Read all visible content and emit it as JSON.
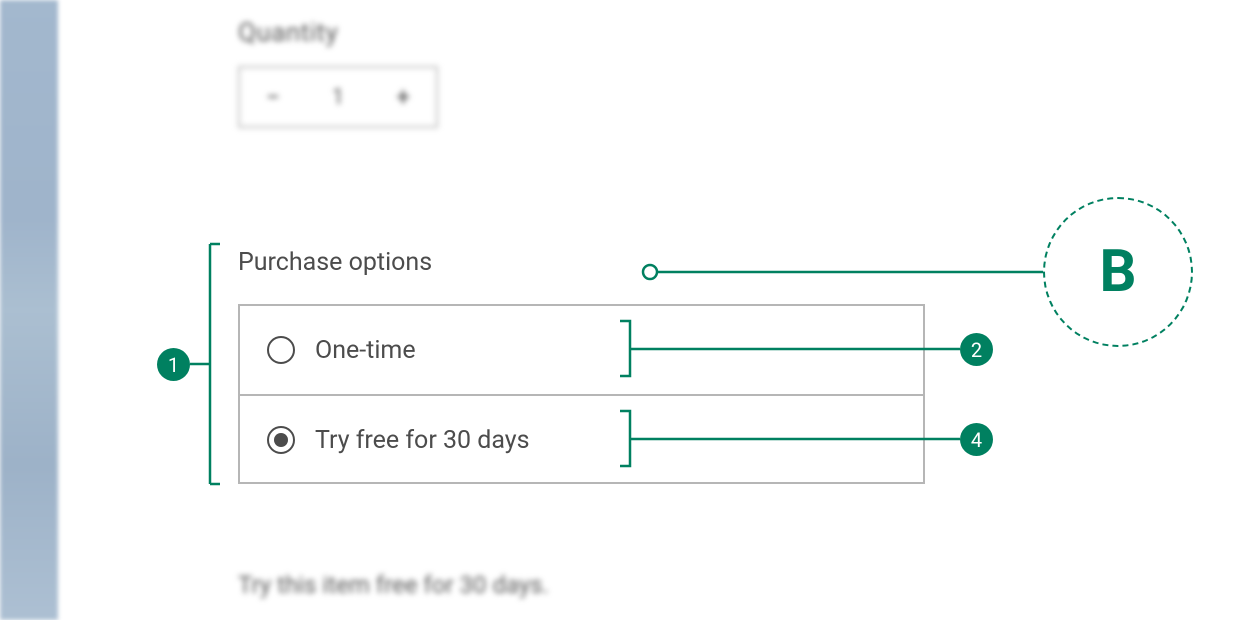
{
  "colors": {
    "accent": "#008060",
    "text": "#4c4c4c",
    "border": "#b6b6b6"
  },
  "quantity": {
    "label": "Quantity",
    "value": "1"
  },
  "purchase": {
    "heading": "Purchase options",
    "options": [
      {
        "label": "One-time",
        "selected": false
      },
      {
        "label": "Try free for 30 days",
        "selected": true
      }
    ]
  },
  "note": "Try this item free for 30 days.",
  "annotations": {
    "badge1": "1",
    "badge2": "2",
    "badge4": "4",
    "letterB": "B"
  }
}
